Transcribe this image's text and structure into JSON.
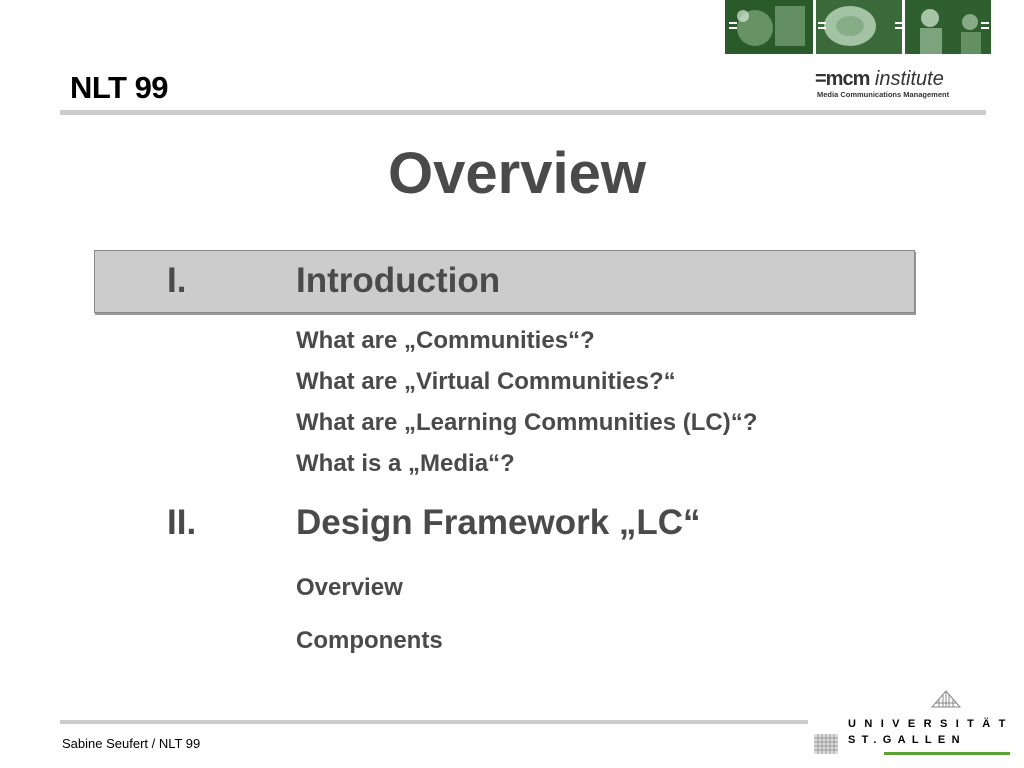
{
  "header": {
    "conference_title": "NLT 99",
    "logo_main_bold": "=mcm",
    "logo_main_italic": " institute",
    "logo_subtitle": "Media Communications Management"
  },
  "slide": {
    "title": "Overview",
    "sections": [
      {
        "number": "I.",
        "title": "Introduction",
        "highlighted": true,
        "items": [
          "What are „Communities“?",
          "What are „Virtual Communities?“",
          "What are „Learning Communities (LC)“?",
          "What is a „Media“?"
        ]
      },
      {
        "number": "II.",
        "title": "Design Framework „LC“",
        "highlighted": false,
        "items": [
          "Overview",
          "Components"
        ]
      }
    ]
  },
  "footer": {
    "author": "Sabine Seufert / NLT 99",
    "university_line1": "UNIVERSITÄT",
    "university_line2": "ST.GALLEN"
  },
  "colors": {
    "text_gray": "#4a4a4a",
    "rule_gray": "#cccccc",
    "highlight_gray": "#cccccc",
    "photo_green": "#1f4a1f",
    "uni_green": "#5aa532"
  },
  "icons": [
    "photo-strip-image",
    "mcm-institute-logo",
    "university-building-icon"
  ]
}
